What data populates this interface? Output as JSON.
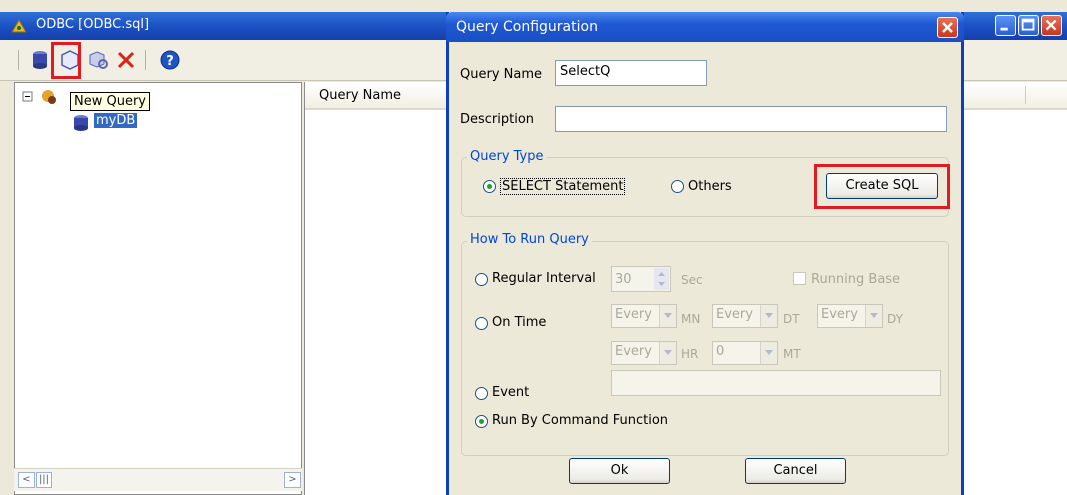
{
  "main_window": {
    "title": "ODBC [ODBC.sql]",
    "tooltip": "New Query",
    "tree_item": "myDB",
    "list_column": "Query Name"
  },
  "dialog": {
    "title": "Query Configuration",
    "query_name_label": "Query Name",
    "query_name_value": "SelectQ",
    "description_label": "Description",
    "description_value": "",
    "query_type": {
      "legend": "Query Type",
      "select_statement": "SELECT Statement",
      "others": "Others",
      "selected": "select_statement",
      "create_sql": "Create SQL"
    },
    "how_to_run": {
      "legend": "How To Run Query",
      "regular_interval": "Regular Interval",
      "interval_value": "30",
      "sec": "Sec",
      "running_base": "Running Base",
      "on_time": "On Time",
      "mn_value": "Every",
      "mn": "MN",
      "dt_value": "Every",
      "dt": "DT",
      "dy_value": "Every",
      "dy": "DY",
      "hr_value": "Every",
      "hr": "HR",
      "mt_value": "0",
      "mt": "MT",
      "event": "Event",
      "event_value": "",
      "run_by_command": "Run By Command Function",
      "selected": "run_by_command"
    },
    "ok": "Ok",
    "cancel": "Cancel"
  },
  "colors": {
    "titlebar_blue": "#1f58d4",
    "highlight_red": "#e01b24",
    "group_title_blue": "#0046d5",
    "radio_green": "#21a121"
  }
}
